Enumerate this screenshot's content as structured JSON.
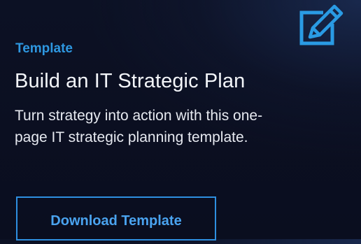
{
  "card": {
    "eyebrow": "Template",
    "title": "Build an IT Strategic Plan",
    "description_lines": [
      "Turn strategy into action with this one-",
      "page IT strategic planning template."
    ],
    "button_label": "Download Template",
    "icon": "edit-pencil-square-icon"
  },
  "colors": {
    "accent": "#2e97e0",
    "button_text": "#4aa3ef",
    "button_border": "#2e8fe0",
    "background": "#0b0f21",
    "text": "#f3f5f9"
  }
}
